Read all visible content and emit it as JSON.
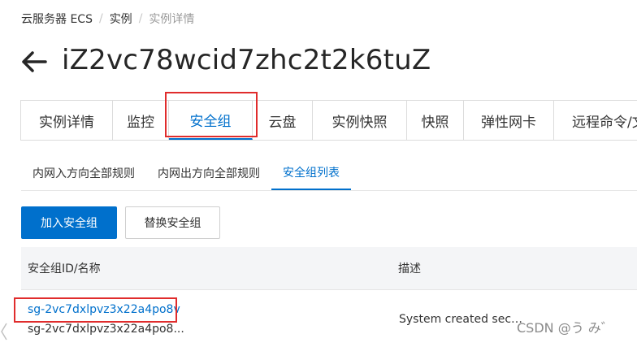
{
  "breadcrumb": {
    "items": [
      "云服务器 ECS",
      "实例",
      "实例详情"
    ],
    "separator": "/"
  },
  "header": {
    "title": "iZ2vc78wcid7zhc2t2k6tuZ",
    "back_icon": "arrow-left-icon"
  },
  "tabs": [
    {
      "label": "实例详情"
    },
    {
      "label": "监控"
    },
    {
      "label": "安全组",
      "active": true
    },
    {
      "label": "云盘"
    },
    {
      "label": "实例快照"
    },
    {
      "label": "快照"
    },
    {
      "label": "弹性网卡"
    },
    {
      "label": "远程命令/文件"
    }
  ],
  "subtabs": [
    {
      "label": "内网入方向全部规则"
    },
    {
      "label": "内网出方向全部规则"
    },
    {
      "label": "安全组列表",
      "active": true
    }
  ],
  "toolbar": {
    "add_label": "加入安全组",
    "replace_label": "替换安全组"
  },
  "table": {
    "columns": [
      "安全组ID/名称",
      "描述"
    ],
    "rows": [
      {
        "id": "sg-2vc7dxlpvz3x22a4po8v",
        "name": "sg-2vc7dxlpvz3x22a4po8...",
        "description": "System created security group."
      }
    ]
  },
  "watermark": "CSDN @う  み゛",
  "colors": {
    "accent": "#0070cc",
    "highlight": "#e02c2c"
  }
}
